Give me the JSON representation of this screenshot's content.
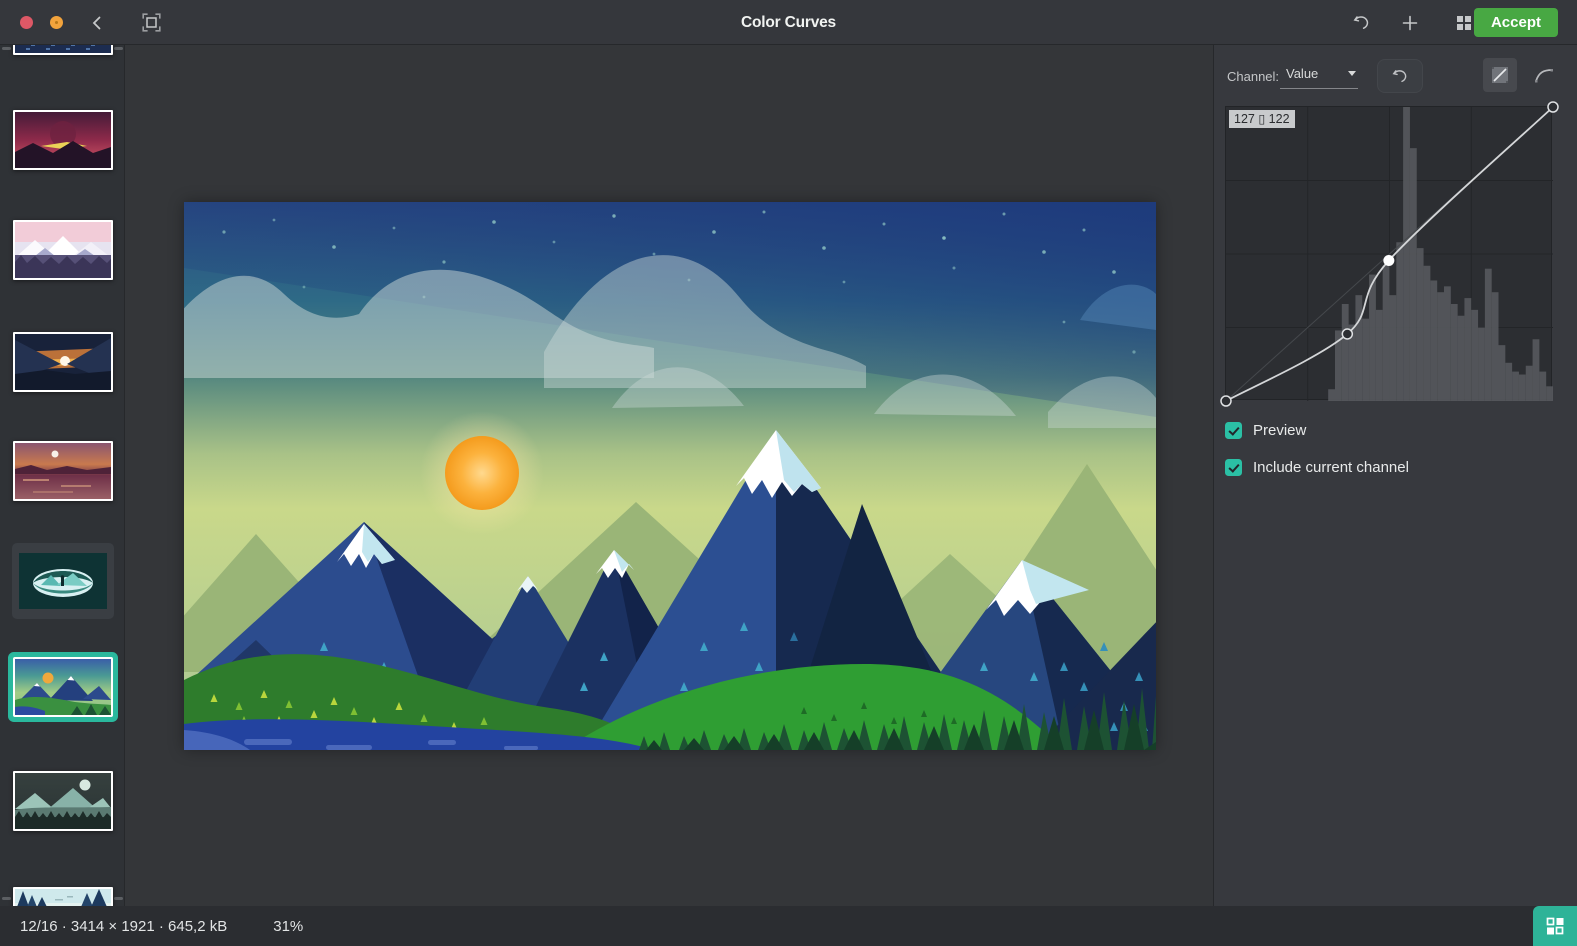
{
  "window": {
    "title": "Color Curves"
  },
  "topbar": {
    "accept_label": "Accept",
    "icons": [
      "close-icon",
      "minimize-icon",
      "back-icon",
      "crop-icon",
      "undo-icon",
      "add-icon",
      "gallery-icon"
    ]
  },
  "sidebar": {
    "thumbnails": [
      {
        "name": "night-stars",
        "partial": true,
        "selected": false
      },
      {
        "name": "crimson-sunset",
        "selected": false
      },
      {
        "name": "pink-mountains",
        "selected": false
      },
      {
        "name": "sunset-valley",
        "selected": false
      },
      {
        "name": "sunset-lake",
        "selected": false
      },
      {
        "name": "cave-view",
        "selected": false
      },
      {
        "name": "green-mountains",
        "selected": true
      },
      {
        "name": "night-mountains",
        "selected": false
      },
      {
        "name": "winter-trees",
        "partial": true,
        "selected": false
      }
    ]
  },
  "curve_panel": {
    "channel_label": "Channel:",
    "channel_value": "Value",
    "tooltip": "127 ▯ 122",
    "current_point": {
      "input": 127,
      "output": 122
    },
    "curve_points": [
      {
        "x": 0.0,
        "y": 0.0
      },
      {
        "x": 0.371,
        "y": 0.228
      },
      {
        "x": 0.498,
        "y": 0.478,
        "solid": true
      },
      {
        "x": 1.0,
        "y": 1.0
      }
    ],
    "histogram": [
      0,
      0,
      0,
      0,
      0,
      0,
      0,
      0,
      0,
      0,
      0,
      0,
      0,
      0,
      0,
      0.04,
      0.24,
      0.33,
      0.26,
      0.36,
      0.28,
      0.43,
      0.31,
      0.46,
      0.36,
      0.54,
      1.0,
      0.86,
      0.52,
      0.46,
      0.41,
      0.37,
      0.39,
      0.33,
      0.29,
      0.35,
      0.31,
      0.25,
      0.45,
      0.37,
      0.19,
      0.13,
      0.1,
      0.09,
      0.12,
      0.21,
      0.1,
      0.05
    ],
    "checkboxes": [
      {
        "label": "Preview",
        "checked": true
      },
      {
        "label": "Include current channel",
        "checked": true
      }
    ]
  },
  "statusbar": {
    "info": "12/16 · 3414 × 1921 · 645,2 kB",
    "zoom": "31%"
  },
  "colors": {
    "accent_teal": "#2ab89d",
    "checkbox_teal": "#2bc0a5",
    "accept_green": "#48a843",
    "close_red": "#dd5866",
    "minimize_orange": "#f2a33c",
    "histogram_gray": "#56585c",
    "curve_line": "#d4d6d8"
  }
}
